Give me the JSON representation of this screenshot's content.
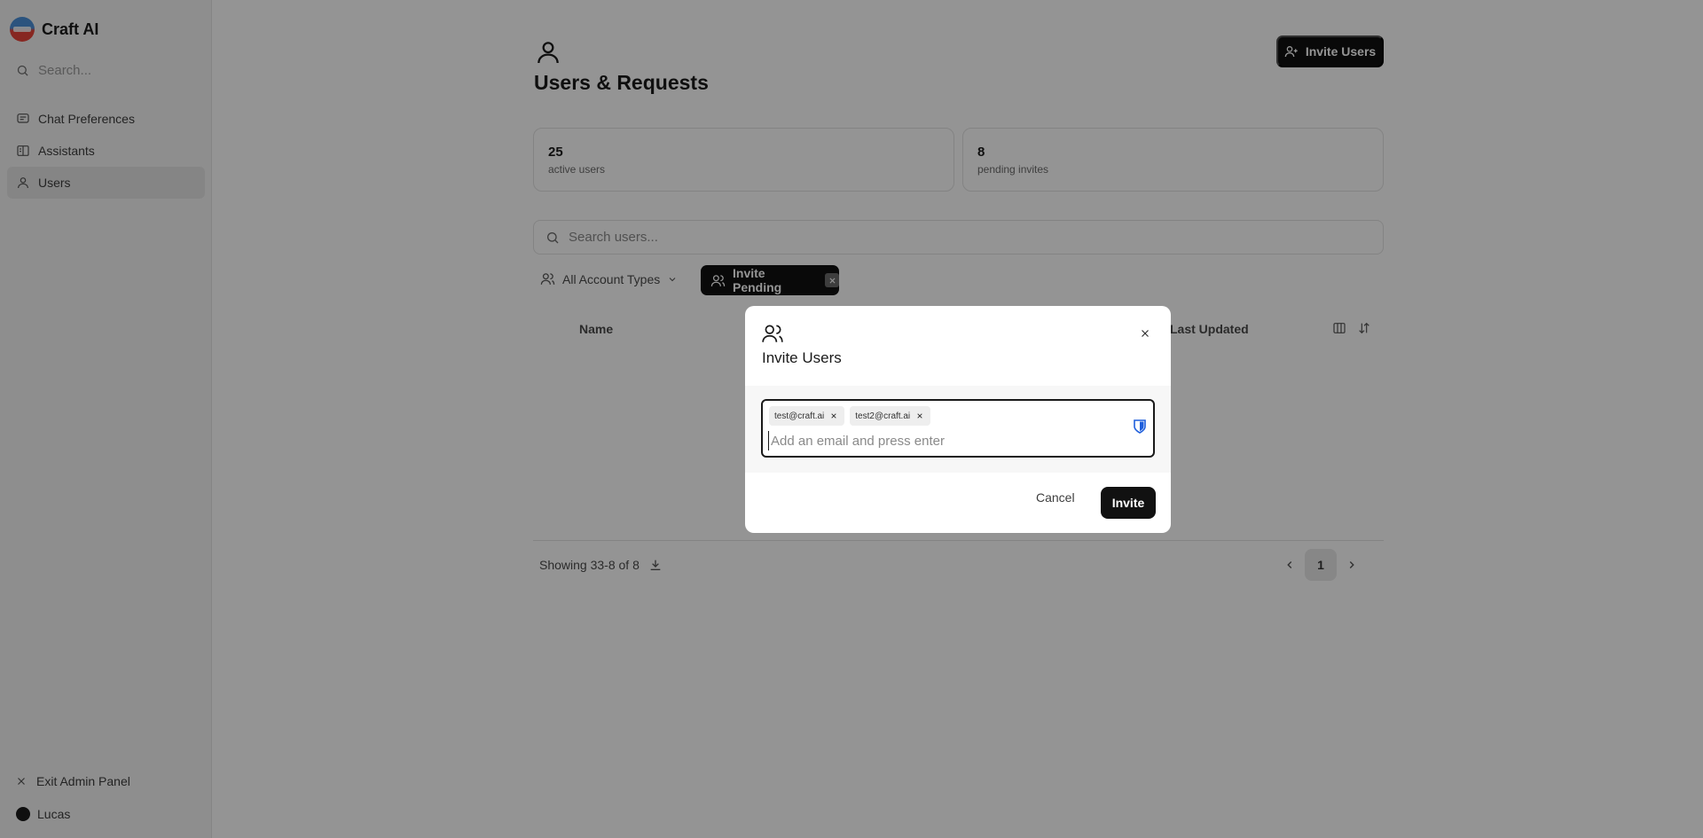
{
  "app": {
    "name": "Craft AI"
  },
  "sidebar": {
    "search_placeholder": "Search...",
    "items": [
      {
        "label": "Chat Preferences",
        "icon": "chat-icon"
      },
      {
        "label": "Assistants",
        "icon": "book-icon"
      },
      {
        "label": "Users",
        "icon": "user-icon",
        "active": true
      }
    ],
    "exit_label": "Exit Admin Panel",
    "user_name": "Lucas"
  },
  "page": {
    "title": "Users & Requests",
    "invite_button": "Invite Users",
    "stats": [
      {
        "value": "25",
        "label": "active users"
      },
      {
        "value": "8",
        "label": "pending invites"
      }
    ],
    "search_placeholder": "Search users...",
    "filters": {
      "account_types": "All Account Types",
      "active_filter": "Invite Pending"
    },
    "table": {
      "columns": [
        "Name",
        "Last Updated"
      ]
    },
    "footer": {
      "showing": "Showing 33-8 of 8",
      "current_page": "1"
    }
  },
  "modal": {
    "title": "Invite Users",
    "emails": [
      "test@craft.ai",
      "test2@craft.ai"
    ],
    "input_placeholder": "Add an email and press enter",
    "cancel_label": "Cancel",
    "invite_label": "Invite"
  },
  "colors": {
    "primary": "#111111",
    "overlay": "rgba(0,0,0,0.42)",
    "password_manager": "#1f5fdc"
  }
}
